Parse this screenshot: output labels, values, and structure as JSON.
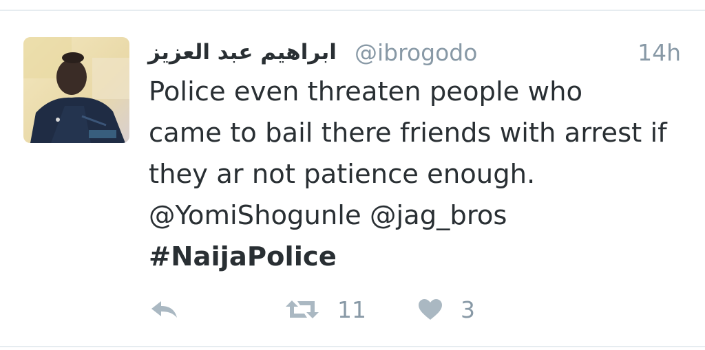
{
  "tweet": {
    "display_name": "ابراهيم عبد العزيز",
    "handle": "@ibrogodo",
    "timestamp": "14h",
    "text_lines": [
      "Police even threaten people who",
      "came to bail there friends with arrest if",
      "they ar not patience enough."
    ],
    "mentions": [
      "@YomiShogunle",
      "@jag_bros"
    ],
    "hashtag": "#NaijaPolice",
    "retweet_count": "11",
    "like_count": "3"
  },
  "icons": {
    "reply": "reply-icon",
    "retweet": "retweet-icon",
    "like": "heart-icon"
  },
  "colors": {
    "text": "#292f33",
    "muted": "#8899a6",
    "icon": "#aab8c2",
    "divider": "#e6ecf0"
  }
}
